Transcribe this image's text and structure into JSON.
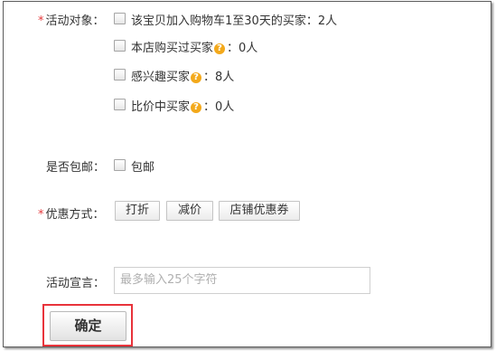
{
  "target": {
    "required_mark": "*",
    "label": "活动对象：",
    "options": [
      {
        "text": "该宝贝加入购物车1至30天的买家：2人",
        "help": false
      },
      {
        "text": "本店购买过买家",
        "suffix": "：0人",
        "help": true
      },
      {
        "text": "感兴趣买家",
        "suffix": "：8人",
        "help": true
      },
      {
        "text": "比价中买家",
        "suffix": "：0人",
        "help": true
      }
    ]
  },
  "shipping": {
    "label": "是否包邮：",
    "option": "包邮"
  },
  "discount": {
    "required_mark": "*",
    "label": "优惠方式：",
    "buttons": [
      "打折",
      "减价",
      "店铺优惠券"
    ]
  },
  "slogan": {
    "label": "活动宣言：",
    "placeholder": "最多输入25个字符"
  },
  "confirm_label": "确定",
  "help_glyph": "?",
  "colors": {
    "required": "#e4393c",
    "help_icon": "#f3a91b",
    "highlight_border": "#e8333b"
  }
}
